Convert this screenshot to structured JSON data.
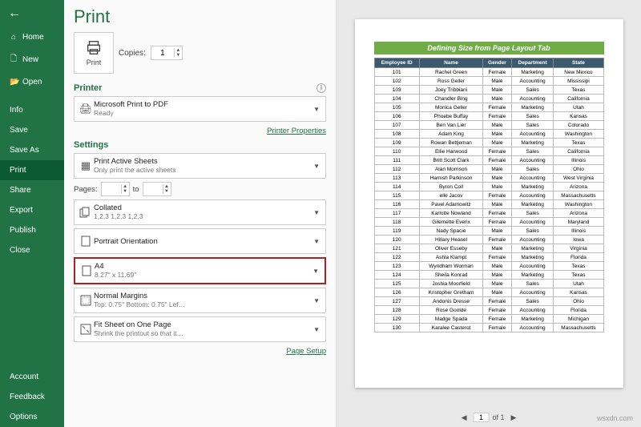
{
  "sidebar": {
    "back": "←",
    "items": [
      {
        "label": "Home",
        "icon": "⌂"
      },
      {
        "label": "New",
        "icon": "🗋"
      },
      {
        "label": "Open",
        "icon": "📂"
      }
    ],
    "menu": [
      "Info",
      "Save",
      "Save As",
      "Print",
      "Share",
      "Export",
      "Publish",
      "Close"
    ],
    "bottom": [
      "Account",
      "Feedback",
      "Options"
    ]
  },
  "print": {
    "title": "Print",
    "button": "Print",
    "copies_label": "Copies:",
    "copies": "1",
    "printer_heading": "Printer",
    "printer": {
      "name": "Microsoft Print to PDF",
      "status": "Ready"
    },
    "printer_props": "Printer Properties",
    "settings_heading": "Settings",
    "active": {
      "t1": "Print Active Sheets",
      "t2": "Only print the active sheets"
    },
    "pages_label": "Pages:",
    "pages_to": "to",
    "collated": {
      "t1": "Collated",
      "t2": "1,2,3    1,2,3    1,2,3"
    },
    "orientation": {
      "t1": "Portrait Orientation",
      "t2": ""
    },
    "paper": {
      "t1": "A4",
      "t2": "8.27\" x 11.69\""
    },
    "margins": {
      "t1": "Normal Margins",
      "t2": "Top: 0.75\" Bottom: 0.75\" Lef…"
    },
    "scaling": {
      "t1": "Fit Sheet on One Page",
      "t2": "Shrink the printout so that it…"
    },
    "page_setup": "Page Setup"
  },
  "preview": {
    "title": "Defining Size from Page Layout Tab",
    "headers": [
      "Employee ID",
      "Name",
      "Gender",
      "Department",
      "State"
    ],
    "rows": [
      [
        "101",
        "Rachel Green",
        "Female",
        "Marketing",
        "New Mexico"
      ],
      [
        "102",
        "Ross Geller",
        "Male",
        "Accounting",
        "Mississipi"
      ],
      [
        "103",
        "Joey Tribbiani",
        "Male",
        "Sales",
        "Texas"
      ],
      [
        "104",
        "Chandler Bing",
        "Male",
        "Accounting",
        "California"
      ],
      [
        "105",
        "Monica Geller",
        "Female",
        "Marketing",
        "Utah"
      ],
      [
        "106",
        "Phoebe Buffay",
        "Female",
        "Sales",
        "Kansas"
      ],
      [
        "107",
        "Ben Van Lier",
        "Male",
        "Sales",
        "Colorado"
      ],
      [
        "108",
        "Adam King",
        "Male",
        "Accounting",
        "Washington"
      ],
      [
        "109",
        "Rowan Bettjeman",
        "Male",
        "Marketing",
        "Texas"
      ],
      [
        "110",
        "Ellie Harwood",
        "Female",
        "Sales",
        "California"
      ],
      [
        "111",
        "Britt Scott Clark",
        "Female",
        "Accounting",
        "Illinois"
      ],
      [
        "112",
        "Alan Morrison",
        "Male",
        "Sales",
        "Ohio"
      ],
      [
        "113",
        "Hamish Parkinson",
        "Male",
        "Accounting",
        "West Virginia"
      ],
      [
        "114",
        "Byron Coll",
        "Male",
        "Marketing",
        "Arizona"
      ],
      [
        "115",
        "elle Jacov",
        "Female",
        "Accounting",
        "Massachusetts"
      ],
      [
        "116",
        "Pavel Adamowitz",
        "Male",
        "Marketing",
        "Washington"
      ],
      [
        "117",
        "Karlotte Nowland",
        "Female",
        "Sales",
        "Arizona"
      ],
      [
        "118",
        "Gilemette Everix",
        "Female",
        "Accounting",
        "Maryland"
      ],
      [
        "119",
        "Nady Spacie",
        "Male",
        "Sales",
        "Illinois"
      ],
      [
        "120",
        "Hillary Heasel",
        "Female",
        "Accounting",
        "Iowa"
      ],
      [
        "121",
        "Oliver Esseby",
        "Male",
        "Marketing",
        "Virginia"
      ],
      [
        "122",
        "Ashla Klampt",
        "Female",
        "Marketing",
        "Florida"
      ],
      [
        "123",
        "Wyndham Worman",
        "Male",
        "Accounting",
        "Texas"
      ],
      [
        "124",
        "Sheila Konrad",
        "Male",
        "Marketing",
        "Texas"
      ],
      [
        "125",
        "Joshia Moorfield",
        "Male",
        "Sales",
        "Utah"
      ],
      [
        "126",
        "Kristopher Gretham",
        "Male",
        "Accounting",
        "Kansas"
      ],
      [
        "127",
        "Andonis Dresse",
        "Female",
        "Sales",
        "Ohio"
      ],
      [
        "128",
        "Rose Goolde",
        "Female",
        "Accounting",
        "Florida"
      ],
      [
        "129",
        "Madge Spada",
        "Female",
        "Marketing",
        "Michigan"
      ],
      [
        "130",
        "Karalee Casterot",
        "Female",
        "Accounting",
        "Massachusetts"
      ]
    ],
    "pager": {
      "current": "1",
      "of": "of 1"
    }
  },
  "watermark": "wsxdn.com"
}
